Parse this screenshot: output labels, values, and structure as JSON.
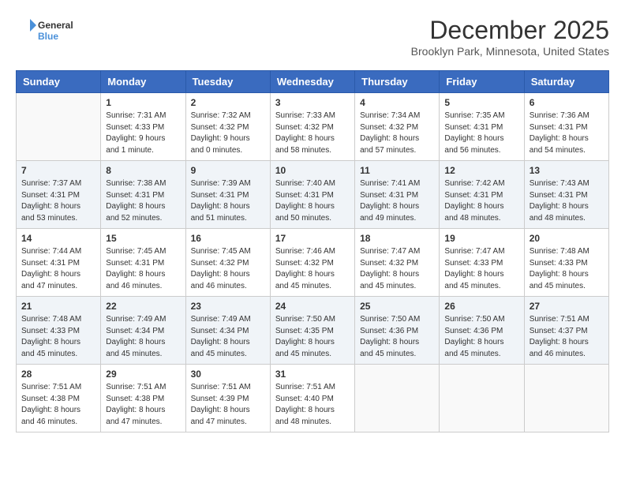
{
  "header": {
    "logo_line1": "General",
    "logo_line2": "Blue",
    "title": "December 2025",
    "subtitle": "Brooklyn Park, Minnesota, United States"
  },
  "days_of_week": [
    "Sunday",
    "Monday",
    "Tuesday",
    "Wednesday",
    "Thursday",
    "Friday",
    "Saturday"
  ],
  "weeks": [
    [
      {
        "num": "",
        "info": ""
      },
      {
        "num": "1",
        "info": "Sunrise: 7:31 AM\nSunset: 4:33 PM\nDaylight: 9 hours\nand 1 minute."
      },
      {
        "num": "2",
        "info": "Sunrise: 7:32 AM\nSunset: 4:32 PM\nDaylight: 9 hours\nand 0 minutes."
      },
      {
        "num": "3",
        "info": "Sunrise: 7:33 AM\nSunset: 4:32 PM\nDaylight: 8 hours\nand 58 minutes."
      },
      {
        "num": "4",
        "info": "Sunrise: 7:34 AM\nSunset: 4:32 PM\nDaylight: 8 hours\nand 57 minutes."
      },
      {
        "num": "5",
        "info": "Sunrise: 7:35 AM\nSunset: 4:31 PM\nDaylight: 8 hours\nand 56 minutes."
      },
      {
        "num": "6",
        "info": "Sunrise: 7:36 AM\nSunset: 4:31 PM\nDaylight: 8 hours\nand 54 minutes."
      }
    ],
    [
      {
        "num": "7",
        "info": "Sunrise: 7:37 AM\nSunset: 4:31 PM\nDaylight: 8 hours\nand 53 minutes."
      },
      {
        "num": "8",
        "info": "Sunrise: 7:38 AM\nSunset: 4:31 PM\nDaylight: 8 hours\nand 52 minutes."
      },
      {
        "num": "9",
        "info": "Sunrise: 7:39 AM\nSunset: 4:31 PM\nDaylight: 8 hours\nand 51 minutes."
      },
      {
        "num": "10",
        "info": "Sunrise: 7:40 AM\nSunset: 4:31 PM\nDaylight: 8 hours\nand 50 minutes."
      },
      {
        "num": "11",
        "info": "Sunrise: 7:41 AM\nSunset: 4:31 PM\nDaylight: 8 hours\nand 49 minutes."
      },
      {
        "num": "12",
        "info": "Sunrise: 7:42 AM\nSunset: 4:31 PM\nDaylight: 8 hours\nand 48 minutes."
      },
      {
        "num": "13",
        "info": "Sunrise: 7:43 AM\nSunset: 4:31 PM\nDaylight: 8 hours\nand 48 minutes."
      }
    ],
    [
      {
        "num": "14",
        "info": "Sunrise: 7:44 AM\nSunset: 4:31 PM\nDaylight: 8 hours\nand 47 minutes."
      },
      {
        "num": "15",
        "info": "Sunrise: 7:45 AM\nSunset: 4:31 PM\nDaylight: 8 hours\nand 46 minutes."
      },
      {
        "num": "16",
        "info": "Sunrise: 7:45 AM\nSunset: 4:32 PM\nDaylight: 8 hours\nand 46 minutes."
      },
      {
        "num": "17",
        "info": "Sunrise: 7:46 AM\nSunset: 4:32 PM\nDaylight: 8 hours\nand 45 minutes."
      },
      {
        "num": "18",
        "info": "Sunrise: 7:47 AM\nSunset: 4:32 PM\nDaylight: 8 hours\nand 45 minutes."
      },
      {
        "num": "19",
        "info": "Sunrise: 7:47 AM\nSunset: 4:33 PM\nDaylight: 8 hours\nand 45 minutes."
      },
      {
        "num": "20",
        "info": "Sunrise: 7:48 AM\nSunset: 4:33 PM\nDaylight: 8 hours\nand 45 minutes."
      }
    ],
    [
      {
        "num": "21",
        "info": "Sunrise: 7:48 AM\nSunset: 4:33 PM\nDaylight: 8 hours\nand 45 minutes."
      },
      {
        "num": "22",
        "info": "Sunrise: 7:49 AM\nSunset: 4:34 PM\nDaylight: 8 hours\nand 45 minutes."
      },
      {
        "num": "23",
        "info": "Sunrise: 7:49 AM\nSunset: 4:34 PM\nDaylight: 8 hours\nand 45 minutes."
      },
      {
        "num": "24",
        "info": "Sunrise: 7:50 AM\nSunset: 4:35 PM\nDaylight: 8 hours\nand 45 minutes."
      },
      {
        "num": "25",
        "info": "Sunrise: 7:50 AM\nSunset: 4:36 PM\nDaylight: 8 hours\nand 45 minutes."
      },
      {
        "num": "26",
        "info": "Sunrise: 7:50 AM\nSunset: 4:36 PM\nDaylight: 8 hours\nand 45 minutes."
      },
      {
        "num": "27",
        "info": "Sunrise: 7:51 AM\nSunset: 4:37 PM\nDaylight: 8 hours\nand 46 minutes."
      }
    ],
    [
      {
        "num": "28",
        "info": "Sunrise: 7:51 AM\nSunset: 4:38 PM\nDaylight: 8 hours\nand 46 minutes."
      },
      {
        "num": "29",
        "info": "Sunrise: 7:51 AM\nSunset: 4:38 PM\nDaylight: 8 hours\nand 47 minutes."
      },
      {
        "num": "30",
        "info": "Sunrise: 7:51 AM\nSunset: 4:39 PM\nDaylight: 8 hours\nand 47 minutes."
      },
      {
        "num": "31",
        "info": "Sunrise: 7:51 AM\nSunset: 4:40 PM\nDaylight: 8 hours\nand 48 minutes."
      },
      {
        "num": "",
        "info": ""
      },
      {
        "num": "",
        "info": ""
      },
      {
        "num": "",
        "info": ""
      }
    ]
  ]
}
